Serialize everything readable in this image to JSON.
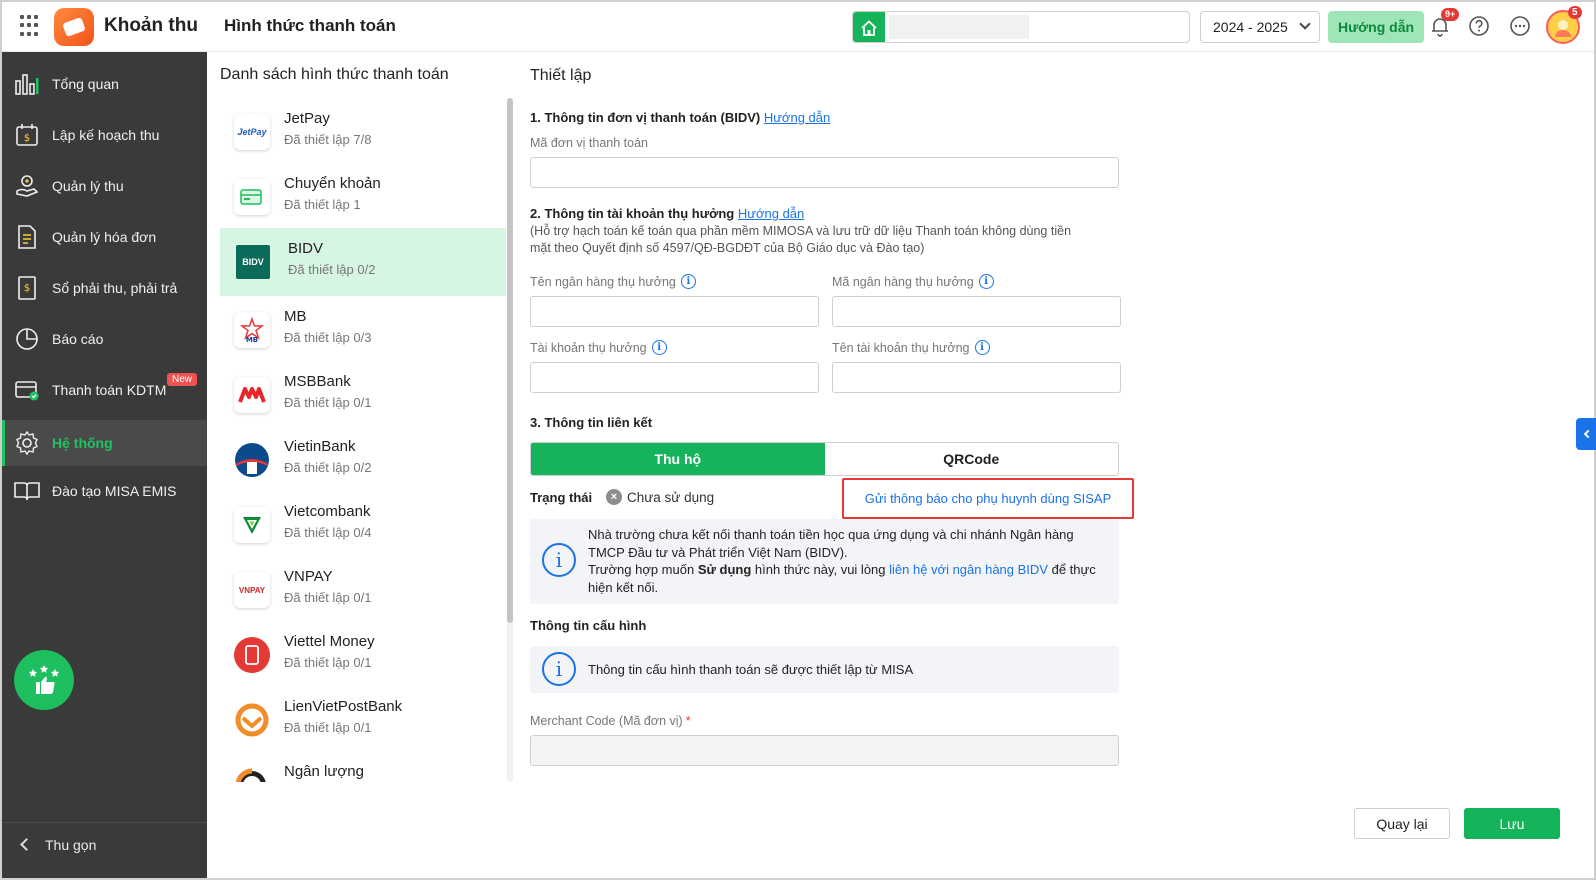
{
  "header": {
    "app_name": "Khoản thu",
    "page_title": "Hình thức thanh toán",
    "school_year": "2024 - 2025",
    "help_label": "Hướng dẫn",
    "notification_count": "9+",
    "avatar_badge": "5"
  },
  "sidebar": {
    "items": [
      {
        "label": "Tổng quan"
      },
      {
        "label": "Lập kế hoạch thu"
      },
      {
        "label": "Quản lý thu"
      },
      {
        "label": "Quản lý hóa đơn"
      },
      {
        "label": "Sổ phải thu, phải trả"
      },
      {
        "label": "Báo cáo"
      },
      {
        "label": "Thanh toán KDTM",
        "badge": "New"
      },
      {
        "label": "Hệ thống"
      },
      {
        "label": "Đào tạo MISA EMIS"
      }
    ],
    "collapse_label": "Thu gọn"
  },
  "payment_list": {
    "title": "Danh sách hình thức thanh toán",
    "items": [
      {
        "name": "JetPay",
        "status": "Đã thiết lập 7/8",
        "logo_text": "JetPay"
      },
      {
        "name": "Chuyển khoản",
        "status": "Đã thiết lập 1",
        "logo_text": ""
      },
      {
        "name": "BIDV",
        "status": "Đã thiết lập 0/2",
        "logo_text": "BIDV"
      },
      {
        "name": "MB",
        "status": "Đã thiết lập 0/3",
        "logo_text": "MB"
      },
      {
        "name": "MSBBank",
        "status": "Đã thiết lập 0/1",
        "logo_text": ""
      },
      {
        "name": "VietinBank",
        "status": "Đã thiết lập 0/2",
        "logo_text": ""
      },
      {
        "name": "Vietcombank",
        "status": "Đã thiết lập 0/4",
        "logo_text": ""
      },
      {
        "name": "VNPAY",
        "status": "Đã thiết lập 0/1",
        "logo_text": "VNPAY"
      },
      {
        "name": "Viettel Money",
        "status": "Đã thiết lập 0/1",
        "logo_text": ""
      },
      {
        "name": "LienVietPostBank",
        "status": "Đã thiết lập 0/1",
        "logo_text": ""
      },
      {
        "name": "Ngân lượng",
        "status": "",
        "logo_text": ""
      }
    ]
  },
  "form": {
    "title": "Thiết lập",
    "section1": {
      "title": "1. Thông tin đơn vị thanh toán (BIDV)",
      "link": "Hướng dẫn",
      "field_label": "Mã đơn vị thanh toán"
    },
    "section2": {
      "title": "2. Thông tin tài khoản thụ hưởng",
      "link": "Hướng dẫn",
      "note": "(Hỗ trợ hạch toán kế toán qua phần mềm MIMOSA và lưu trữ dữ liệu Thanh toán không dùng tiền mặt theo Quyết định số 4597/QĐ-BGDĐT của Bộ Giáo dục và Đào tạo)",
      "bank_name_label": "Tên ngân hàng thụ hưởng",
      "bank_code_label": "Mã ngân hàng thụ hưởng",
      "account_label": "Tài khoản thụ hưởng",
      "account_name_label": "Tên tài khoản thụ hưởng"
    },
    "section3": {
      "title": "3. Thông tin liên kết",
      "tabs": [
        "Thu hộ",
        "QRCode"
      ],
      "status_label": "Trạng thái",
      "status_value": "Chưa sử dụng",
      "send_button": "Gửi thông báo cho phụ huynh dùng SISAP",
      "info_line1": "Nhà trường chưa kết nối thanh toán tiền học qua ứng dụng và chi nhánh Ngân hàng TMCP Đầu tư và Phát triển Việt Nam (BIDV).",
      "info_line2_a": "Trường hợp muốn ",
      "info_line2_b": "Sử dụng",
      "info_line2_c": " hình thức này, vui lòng ",
      "info_line2_link": "liên hệ với ngân hàng BIDV",
      "info_line2_d": " để thực hiện kết nối."
    },
    "config": {
      "title": "Thông tin cấu hình",
      "info": "Thông tin cấu hình thanh toán sẽ được thiết lập từ MISA",
      "merchant_label": "Merchant Code (Mã đơn vị)",
      "required_mark": "*"
    }
  },
  "footer": {
    "back_label": "Quay lại",
    "save_label": "Lưu"
  },
  "colors": {
    "primary_green": "#16b45a",
    "sidebar_bg": "#3a3a3a",
    "link_blue": "#1a73e8",
    "highlight_red": "#e53935"
  }
}
